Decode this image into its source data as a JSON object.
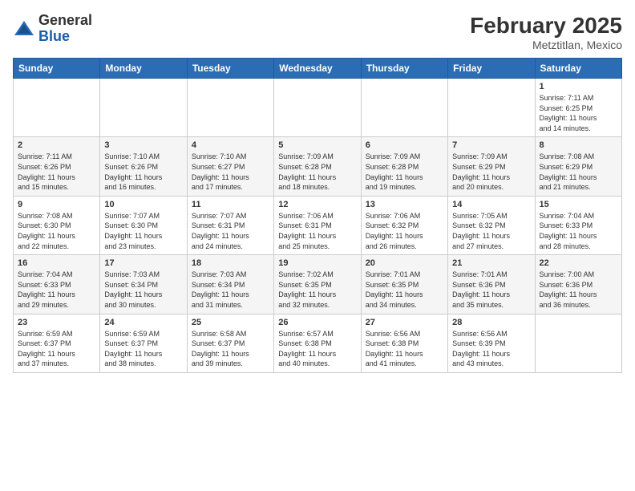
{
  "header": {
    "logo": {
      "line1": "General",
      "line2": "Blue"
    },
    "month_year": "February 2025",
    "location": "Metztitlan, Mexico"
  },
  "days_of_week": [
    "Sunday",
    "Monday",
    "Tuesday",
    "Wednesday",
    "Thursday",
    "Friday",
    "Saturday"
  ],
  "weeks": [
    [
      {
        "day": "",
        "info": ""
      },
      {
        "day": "",
        "info": ""
      },
      {
        "day": "",
        "info": ""
      },
      {
        "day": "",
        "info": ""
      },
      {
        "day": "",
        "info": ""
      },
      {
        "day": "",
        "info": ""
      },
      {
        "day": "1",
        "info": "Sunrise: 7:11 AM\nSunset: 6:25 PM\nDaylight: 11 hours\nand 14 minutes."
      }
    ],
    [
      {
        "day": "2",
        "info": "Sunrise: 7:11 AM\nSunset: 6:26 PM\nDaylight: 11 hours\nand 15 minutes."
      },
      {
        "day": "3",
        "info": "Sunrise: 7:10 AM\nSunset: 6:26 PM\nDaylight: 11 hours\nand 16 minutes."
      },
      {
        "day": "4",
        "info": "Sunrise: 7:10 AM\nSunset: 6:27 PM\nDaylight: 11 hours\nand 17 minutes."
      },
      {
        "day": "5",
        "info": "Sunrise: 7:09 AM\nSunset: 6:28 PM\nDaylight: 11 hours\nand 18 minutes."
      },
      {
        "day": "6",
        "info": "Sunrise: 7:09 AM\nSunset: 6:28 PM\nDaylight: 11 hours\nand 19 minutes."
      },
      {
        "day": "7",
        "info": "Sunrise: 7:09 AM\nSunset: 6:29 PM\nDaylight: 11 hours\nand 20 minutes."
      },
      {
        "day": "8",
        "info": "Sunrise: 7:08 AM\nSunset: 6:29 PM\nDaylight: 11 hours\nand 21 minutes."
      }
    ],
    [
      {
        "day": "9",
        "info": "Sunrise: 7:08 AM\nSunset: 6:30 PM\nDaylight: 11 hours\nand 22 minutes."
      },
      {
        "day": "10",
        "info": "Sunrise: 7:07 AM\nSunset: 6:30 PM\nDaylight: 11 hours\nand 23 minutes."
      },
      {
        "day": "11",
        "info": "Sunrise: 7:07 AM\nSunset: 6:31 PM\nDaylight: 11 hours\nand 24 minutes."
      },
      {
        "day": "12",
        "info": "Sunrise: 7:06 AM\nSunset: 6:31 PM\nDaylight: 11 hours\nand 25 minutes."
      },
      {
        "day": "13",
        "info": "Sunrise: 7:06 AM\nSunset: 6:32 PM\nDaylight: 11 hours\nand 26 minutes."
      },
      {
        "day": "14",
        "info": "Sunrise: 7:05 AM\nSunset: 6:32 PM\nDaylight: 11 hours\nand 27 minutes."
      },
      {
        "day": "15",
        "info": "Sunrise: 7:04 AM\nSunset: 6:33 PM\nDaylight: 11 hours\nand 28 minutes."
      }
    ],
    [
      {
        "day": "16",
        "info": "Sunrise: 7:04 AM\nSunset: 6:33 PM\nDaylight: 11 hours\nand 29 minutes."
      },
      {
        "day": "17",
        "info": "Sunrise: 7:03 AM\nSunset: 6:34 PM\nDaylight: 11 hours\nand 30 minutes."
      },
      {
        "day": "18",
        "info": "Sunrise: 7:03 AM\nSunset: 6:34 PM\nDaylight: 11 hours\nand 31 minutes."
      },
      {
        "day": "19",
        "info": "Sunrise: 7:02 AM\nSunset: 6:35 PM\nDaylight: 11 hours\nand 32 minutes."
      },
      {
        "day": "20",
        "info": "Sunrise: 7:01 AM\nSunset: 6:35 PM\nDaylight: 11 hours\nand 34 minutes."
      },
      {
        "day": "21",
        "info": "Sunrise: 7:01 AM\nSunset: 6:36 PM\nDaylight: 11 hours\nand 35 minutes."
      },
      {
        "day": "22",
        "info": "Sunrise: 7:00 AM\nSunset: 6:36 PM\nDaylight: 11 hours\nand 36 minutes."
      }
    ],
    [
      {
        "day": "23",
        "info": "Sunrise: 6:59 AM\nSunset: 6:37 PM\nDaylight: 11 hours\nand 37 minutes."
      },
      {
        "day": "24",
        "info": "Sunrise: 6:59 AM\nSunset: 6:37 PM\nDaylight: 11 hours\nand 38 minutes."
      },
      {
        "day": "25",
        "info": "Sunrise: 6:58 AM\nSunset: 6:37 PM\nDaylight: 11 hours\nand 39 minutes."
      },
      {
        "day": "26",
        "info": "Sunrise: 6:57 AM\nSunset: 6:38 PM\nDaylight: 11 hours\nand 40 minutes."
      },
      {
        "day": "27",
        "info": "Sunrise: 6:56 AM\nSunset: 6:38 PM\nDaylight: 11 hours\nand 41 minutes."
      },
      {
        "day": "28",
        "info": "Sunrise: 6:56 AM\nSunset: 6:39 PM\nDaylight: 11 hours\nand 43 minutes."
      },
      {
        "day": "",
        "info": ""
      }
    ]
  ]
}
